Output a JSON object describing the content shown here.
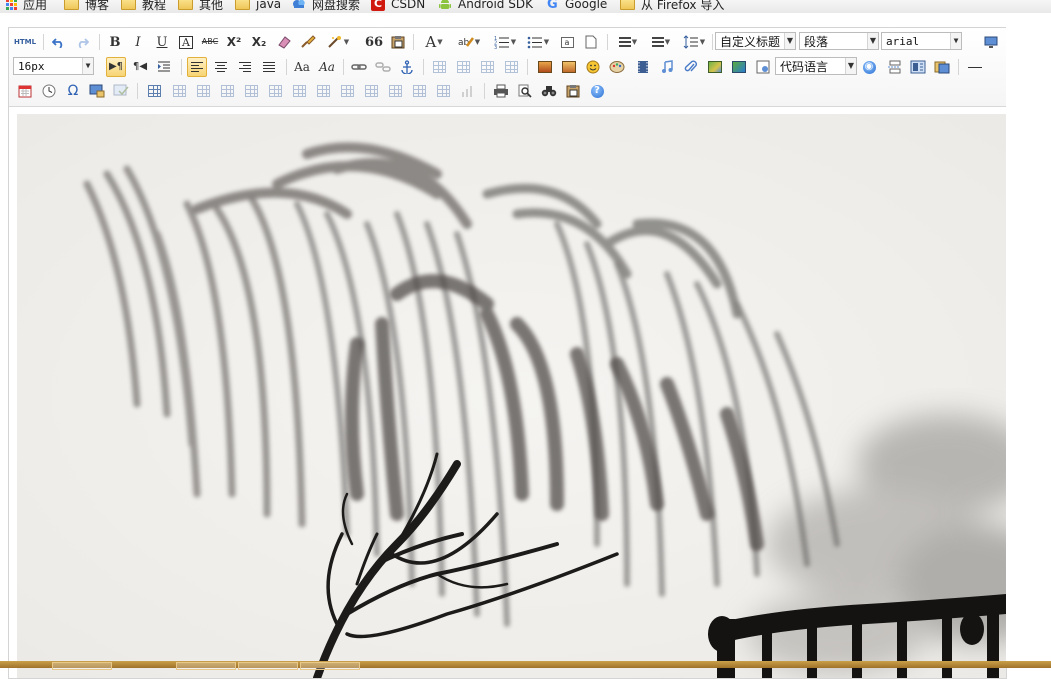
{
  "bookmarks": {
    "items": [
      {
        "label": "应用",
        "icon": "apps-grid-icon"
      },
      {
        "label": "博客",
        "icon": "folder-icon"
      },
      {
        "label": "教程",
        "icon": "folder-icon"
      },
      {
        "label": "其他",
        "icon": "folder-icon"
      },
      {
        "label": "java",
        "icon": "folder-icon"
      },
      {
        "label": "网盘搜索",
        "icon": "cloud-search-icon"
      },
      {
        "label": "CSDN",
        "icon": "csdn-icon"
      },
      {
        "label": "Android SDK",
        "icon": "android-icon"
      },
      {
        "label": "Google",
        "icon": "google-icon"
      },
      {
        "label": "从 Firefox 导入",
        "icon": "folder-icon"
      }
    ]
  },
  "toolbar": {
    "html_label": "HTML",
    "bold": "B",
    "italic": "I",
    "underline": "U",
    "fontborder": "A",
    "strike": "ABC",
    "superscript": "X²",
    "subscript": "X₂",
    "blockquote": "66",
    "forecolor": "A",
    "customstyle": "自定义标题",
    "paragraph": "段落",
    "fontfamily": "arial",
    "fontsize": "16px",
    "code_language": "代码语言",
    "omega": "Ω",
    "help": "?"
  },
  "colors": {
    "accent_active": "#f7d474",
    "toolbar_bg": "#f5f5f5",
    "border": "#d4d4d4",
    "taskbar": "#b8892f"
  }
}
